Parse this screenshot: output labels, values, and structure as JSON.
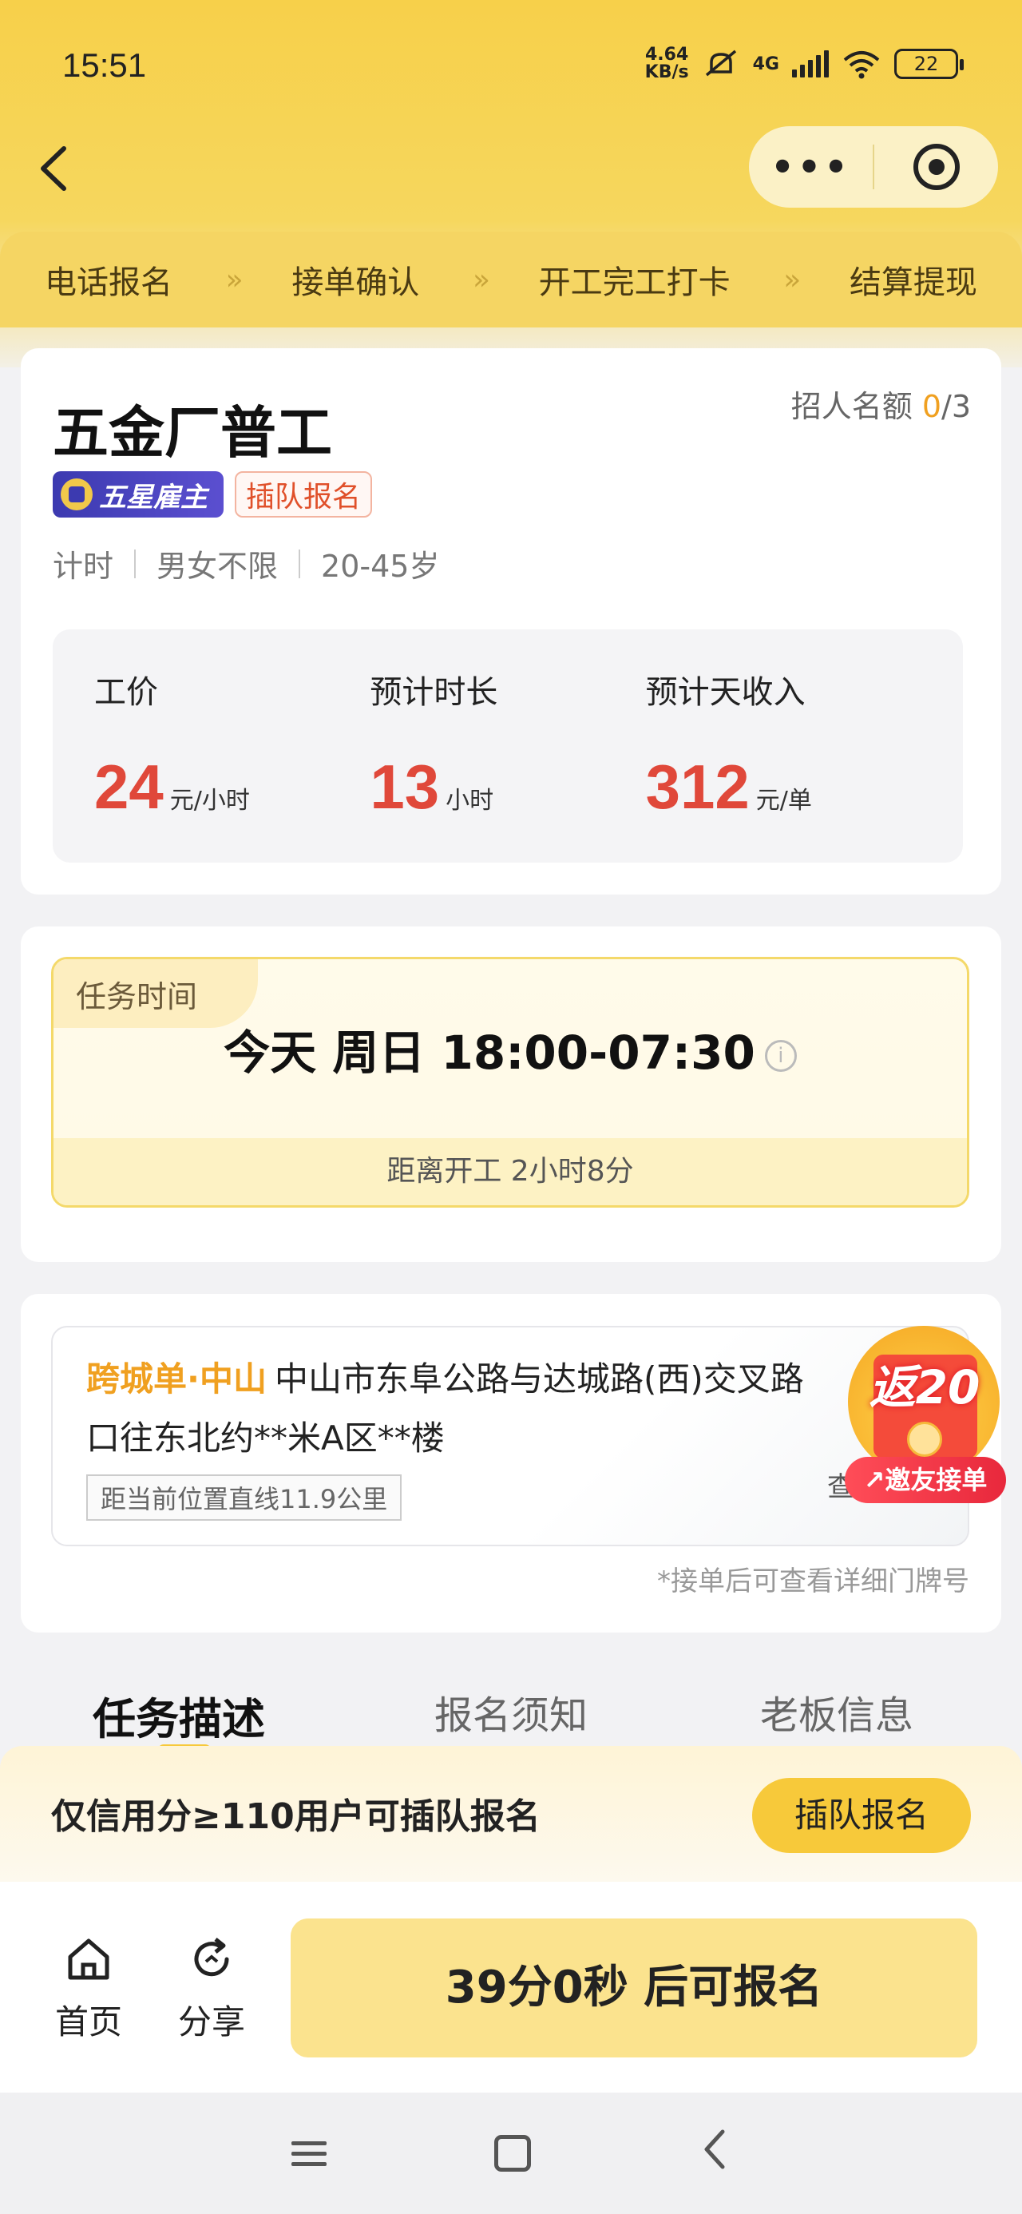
{
  "status_bar": {
    "time": "15:51",
    "net_speed_value": "4.64",
    "net_speed_unit": "KB/s",
    "network": "4G",
    "battery": "22"
  },
  "nav": {
    "back_icon": "chevron-left-icon",
    "more_icon": "more-dots-icon",
    "close_icon": "target-icon"
  },
  "steps": [
    "电话报名",
    "接单确认",
    "开工完工打卡",
    "结算提现"
  ],
  "step_separator": "»",
  "job": {
    "title": "五金厂普工",
    "quota_label": "招人名额",
    "quota_filled": "0",
    "quota_total": "/3",
    "badge_star": "五星雇主",
    "badge_jump": "插队报名",
    "tags": [
      "计时",
      "男女不限",
      "20-45岁"
    ],
    "pay": [
      {
        "label": "工价",
        "value": "24",
        "unit": "元/小时"
      },
      {
        "label": "预计时长",
        "value": "13",
        "unit": "小时"
      },
      {
        "label": "预计天收入",
        "value": "312",
        "unit": "元/单"
      }
    ]
  },
  "task_time": {
    "label": "任务时间",
    "date": "今天 周日 18:00-07:30",
    "info_icon": "i",
    "countdown": "距离开工 2小时8分"
  },
  "address": {
    "city_tag": "跨城单·中山",
    "text": "中山市东阜公路与达城路(西)交叉路口往东北约**米A区**楼",
    "distance": "距当前位置直线11.9公里",
    "note": "*接单后可查看详细门牌号",
    "peek_text": "查"
  },
  "promo": {
    "amount": "返20",
    "invite": "↗邀友接单"
  },
  "tabs": [
    "任务描述",
    "报名须知",
    "老板信息"
  ],
  "jump_bar": {
    "text": "仅信用分≥110用户可插队报名",
    "button": "插队报名"
  },
  "bottom": {
    "home": "首页",
    "share": "分享",
    "register": "39分0秒 后可报名"
  },
  "colors": {
    "brand_yellow": "#f7c93a",
    "price_red": "#e0483a",
    "accent_orange": "#f0a020"
  }
}
